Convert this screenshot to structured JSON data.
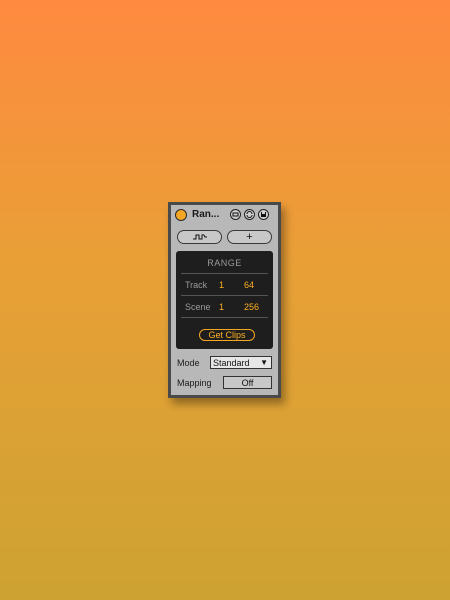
{
  "device": {
    "title": "Ran...",
    "power_color": "#f5a623",
    "accent_color": "#ffb020",
    "title_icons": [
      "minimize-icon",
      "hot-swap-icon",
      "save-icon"
    ],
    "buttons": {
      "map_icon": "mapping-icon",
      "add_label": "+"
    },
    "range": {
      "title": "RANGE",
      "track_label": "Track",
      "track_from": "1",
      "track_to": "64",
      "scene_label": "Scene",
      "scene_from": "1",
      "scene_to": "256",
      "get_clips_label": "Get Clips"
    },
    "mode": {
      "label": "Mode",
      "value": "Standard"
    },
    "mapping": {
      "label": "Mapping",
      "value": "Off"
    }
  }
}
